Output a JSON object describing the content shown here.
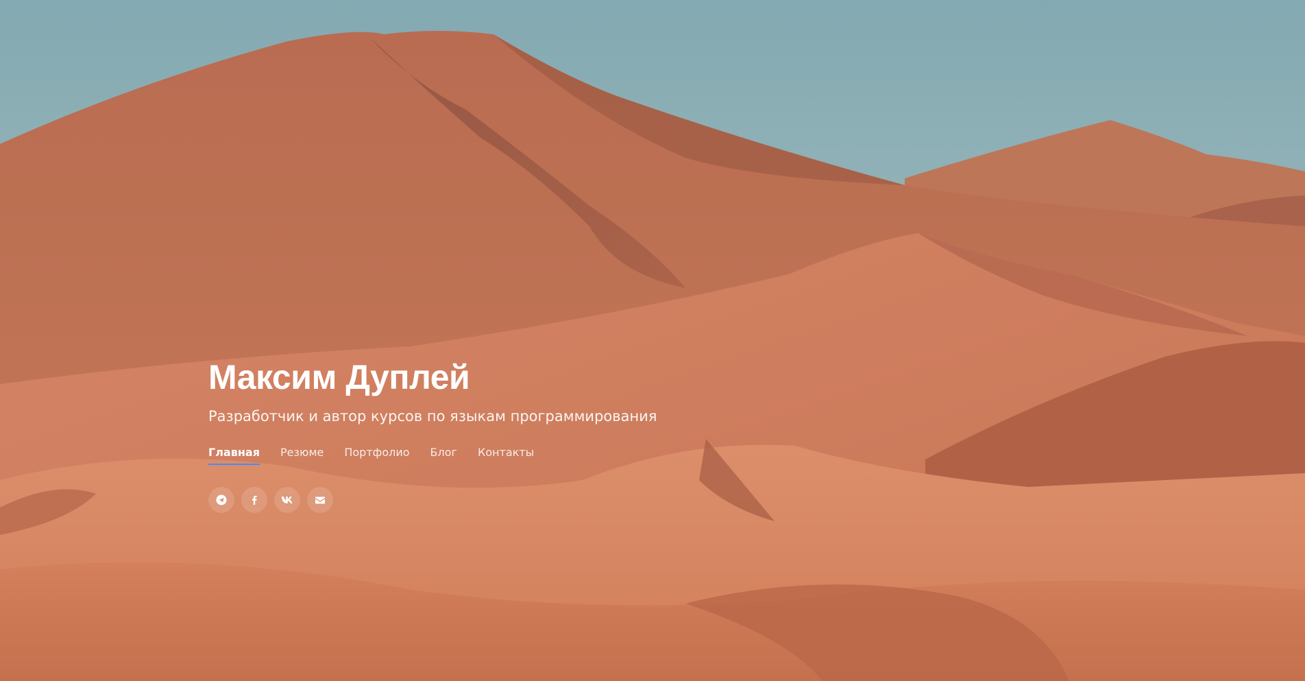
{
  "hero": {
    "name": "Максим Дуплей",
    "subtitle": "Разработчик и автор курсов по языкам программирования"
  },
  "nav": {
    "items": [
      {
        "label": "Главная",
        "active": true
      },
      {
        "label": "Резюме",
        "active": false
      },
      {
        "label": "Портфолио",
        "active": false
      },
      {
        "label": "Блог",
        "active": false
      },
      {
        "label": "Контакты",
        "active": false
      }
    ]
  },
  "social": {
    "icons": [
      "telegram-icon",
      "facebook-icon",
      "vk-icon",
      "mail-icon"
    ]
  },
  "colors": {
    "sky": "#a9c8cd",
    "sand": "#e08a62",
    "accent": "#4a8bf0",
    "text": "#ffffff"
  }
}
